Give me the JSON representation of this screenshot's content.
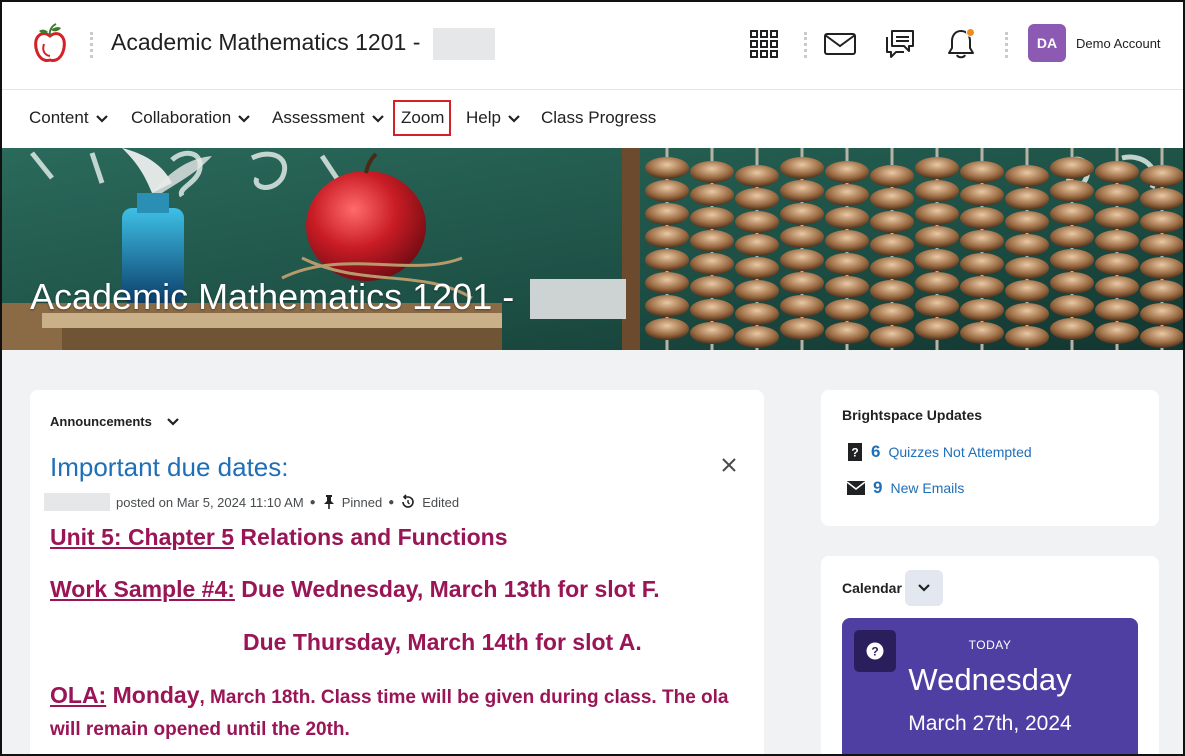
{
  "header": {
    "course_title": "Academic Mathematics 1201 -",
    "account_initials": "DA",
    "account_name": "Demo Account",
    "notification_dot_color": "#f18a1c",
    "icons": [
      "apple-logo-icon",
      "app-grid-icon",
      "mail-icon",
      "chat-icon",
      "bell-icon"
    ]
  },
  "nav": {
    "items": [
      {
        "label": "Content",
        "dropdown": true
      },
      {
        "label": "Collaboration",
        "dropdown": true
      },
      {
        "label": "Assessment",
        "dropdown": true
      },
      {
        "label": "Zoom",
        "dropdown": false,
        "highlighted": true
      },
      {
        "label": "Help",
        "dropdown": true
      },
      {
        "label": "Class Progress",
        "dropdown": false
      }
    ],
    "highlight_color": "#d62027"
  },
  "banner": {
    "title": "Academic Mathematics 1201 -"
  },
  "announcements": {
    "widget_title": "Announcements",
    "title": "Important due dates:",
    "meta": {
      "posted": "posted on Mar 5, 2024 11:10 AM",
      "pinned": "Pinned",
      "edited": "Edited"
    },
    "lines": {
      "l1_link": "Unit 5: Chapter 5",
      "l1_text": " Relations and Functions",
      "l2_link": "Work Sample #4:",
      "l2_text": " Due Wednesday, March 13th for slot F.",
      "l3_text": "Due Thursday, March 14th for slot A.",
      "l4_link": "OLA:",
      "l4_text": " Monday",
      "l4_small": ", March 18th. Class time will be given during class. The ola",
      "l5_text": "will remain opened until the 20th."
    },
    "text_color": "#9a1556",
    "title_color": "#1f6fb8"
  },
  "updates": {
    "title": "Brightspace Updates",
    "items": [
      {
        "count": "6",
        "label": "Quizzes Not Attempted",
        "icon": "quiz-question-icon"
      },
      {
        "count": "9",
        "label": "New Emails",
        "icon": "envelope-icon"
      }
    ]
  },
  "calendar": {
    "title": "Calendar",
    "today_label": "TODAY",
    "day": "Wednesday",
    "date": "March 27th, 2024",
    "box_color": "#4f3fa2"
  }
}
